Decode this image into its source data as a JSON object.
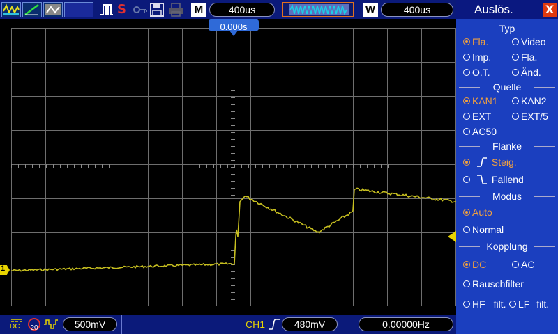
{
  "topbar": {
    "timebase_letter": "M",
    "timebase_value": "400us",
    "window_letter": "W",
    "window_value": "400us",
    "run_state": "S"
  },
  "trigger_marker": "0.000s",
  "channel_marker": "1",
  "side": {
    "title": "Auslös.",
    "close": "X",
    "sections": {
      "typ": "Typ",
      "quelle": "Quelle",
      "flanke": "Flanke",
      "modus": "Modus",
      "kopplung": "Kopplung"
    },
    "typ_options": [
      "Fla.",
      "Video",
      "Imp.",
      "Fla.",
      "O.T.",
      "Änd."
    ],
    "quelle_options": [
      "KAN1",
      "KAN2",
      "EXT",
      "EXT/5",
      "AC50"
    ],
    "flanke_options": [
      "Steig.",
      "Fallend"
    ],
    "modus_options": [
      "Auto",
      "Normal"
    ],
    "kopplung_options": [
      "DC",
      "AC",
      "Rauschfilter",
      "HF",
      "filt.",
      "LF",
      "filt."
    ]
  },
  "bottombar": {
    "coupling": "DC",
    "bw_limit": "20",
    "ch1_scale": "500mV",
    "trigger_channel": "CH1",
    "trigger_level": "480mV",
    "frequency": "0.00000Hz"
  },
  "colors": {
    "trace": "#c8c020",
    "grid": "#6e6e6e",
    "panel": "#1b3fbf",
    "bar": "#0b1a7a",
    "selected": "#f0a040"
  }
}
